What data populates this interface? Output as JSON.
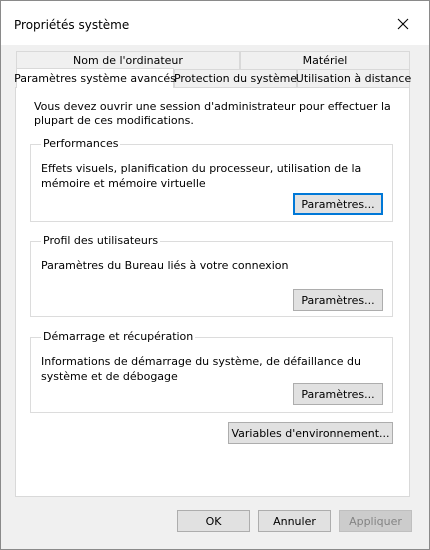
{
  "window": {
    "title": "Propriétés système"
  },
  "tabs": {
    "row_back": [
      "Nom de l'ordinateur",
      "Matériel"
    ],
    "row_front": [
      "Paramètres système avancés",
      "Protection du système",
      "Utilisation à distance"
    ]
  },
  "panel": {
    "intro": "Vous devez ouvrir une session d'administrateur pour effectuer la plupart de ces modifications.",
    "performance": {
      "title": "Performances",
      "description": "Effets visuels, planification du processeur, utilisation de la mémoire et mémoire virtuelle",
      "button": "Paramètres..."
    },
    "profiles": {
      "title": "Profil des utilisateurs",
      "description": "Paramètres du Bureau liés à votre connexion",
      "button": "Paramètres..."
    },
    "startup": {
      "title": "Démarrage et récupération",
      "description": "Informations de démarrage du système, de défaillance du système et de débogage",
      "button": "Paramètres..."
    },
    "env_button": "Variables d'environnement..."
  },
  "footer": {
    "ok": "OK",
    "cancel": "Annuler",
    "apply": "Appliquer"
  },
  "icons": {
    "close": "close-icon"
  }
}
